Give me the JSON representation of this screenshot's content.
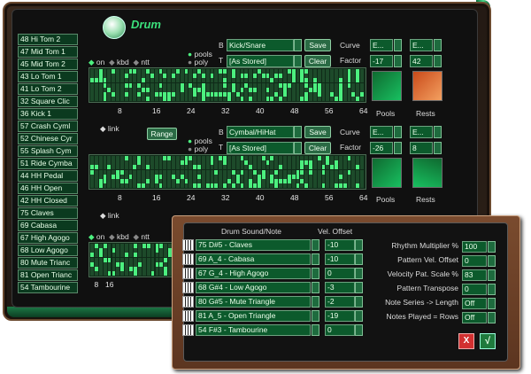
{
  "app": {
    "title": "Drum"
  },
  "section1": {
    "drums": [
      "48 Hi Tom 2",
      "47 Mid Tom 1",
      "45 Mid Tom 2",
      "43 Lo Tom 1",
      "41 Lo Tom 2",
      "32 Square Clic",
      "36 Kick 1"
    ],
    "b_label": "B",
    "t_label": "T",
    "preset": "Kick/Snare",
    "stored": "[As Stored]",
    "save": "Save",
    "clear": "Clear",
    "curve_label": "Curve",
    "factor_label": "Factor",
    "curve1": "E...",
    "curve2": "E...",
    "factor1": "-17",
    "factor2": "42",
    "modes": [
      "on",
      "kbd",
      "ntt"
    ],
    "pools_label": "pools",
    "poly_label": "poly",
    "pools_caption": "Pools",
    "rests_caption": "Rests"
  },
  "section2": {
    "drums": [
      "57 Crash Cyml",
      "52 Chinese Cyr",
      "55 Splash Cym",
      "51 Ride Cymba",
      "44 HH Pedal",
      "46 HH Open",
      "42 HH Closed"
    ],
    "link_label": "link",
    "range": "Range",
    "b_label": "B",
    "t_label": "T",
    "preset": "Cymbal/HiHat",
    "stored": "[As Stored]",
    "save": "Save",
    "clear": "Clear",
    "curve_label": "Curve",
    "factor_label": "Factor",
    "curve1": "E...",
    "curve2": "E...",
    "factor1": "-26",
    "factor2": "8",
    "pools_label": "pools",
    "poly_label": "poly",
    "pools_caption": "Pools",
    "rests_caption": "Rests"
  },
  "section3": {
    "drums": [
      "75 Claves",
      "69 Cabasa",
      "67 High Agogo",
      "68 Low Agogo",
      "80 Mute Trianc",
      "81 Open Trianc",
      "54 Tambourine"
    ],
    "link_label": "link",
    "modes": [
      "on",
      "kbd",
      "ntt"
    ]
  },
  "ticks": [
    "8",
    "16",
    "24",
    "32",
    "40",
    "48",
    "56",
    "64"
  ],
  "dialog": {
    "col_sound": "Drum Sound/Note",
    "col_vel": "Vel. Offset",
    "rows": [
      {
        "sound": "75 D#5 - Claves",
        "vel": "-10"
      },
      {
        "sound": "69 A_4 - Cabasa",
        "vel": "-10"
      },
      {
        "sound": "67 G_4 - High Agogo",
        "vel": "0"
      },
      {
        "sound": "68 G#4 - Low Agogo",
        "vel": "-3"
      },
      {
        "sound": "80 G#5 - Mute Triangle",
        "vel": "-2"
      },
      {
        "sound": "81 A_5 - Open Triangle",
        "vel": "-19"
      },
      {
        "sound": "54 F#3 - Tambourine",
        "vel": "0"
      }
    ],
    "settings": [
      {
        "label": "Rhythm Multiplier %",
        "value": "100"
      },
      {
        "label": "Pattern Vel. Offset",
        "value": "0"
      },
      {
        "label": "Velocity Pat. Scale %",
        "value": "83"
      },
      {
        "label": "Pattern Transpose",
        "value": "0"
      },
      {
        "label": "Note Series -> Length",
        "value": "Off"
      },
      {
        "label": "Notes Played = Rows",
        "value": "Off"
      }
    ],
    "cancel": "X",
    "ok": "√"
  },
  "colors": {
    "accent": "#3be07b",
    "frame": "#6b4a30",
    "on_cell": "#4cf07f"
  }
}
